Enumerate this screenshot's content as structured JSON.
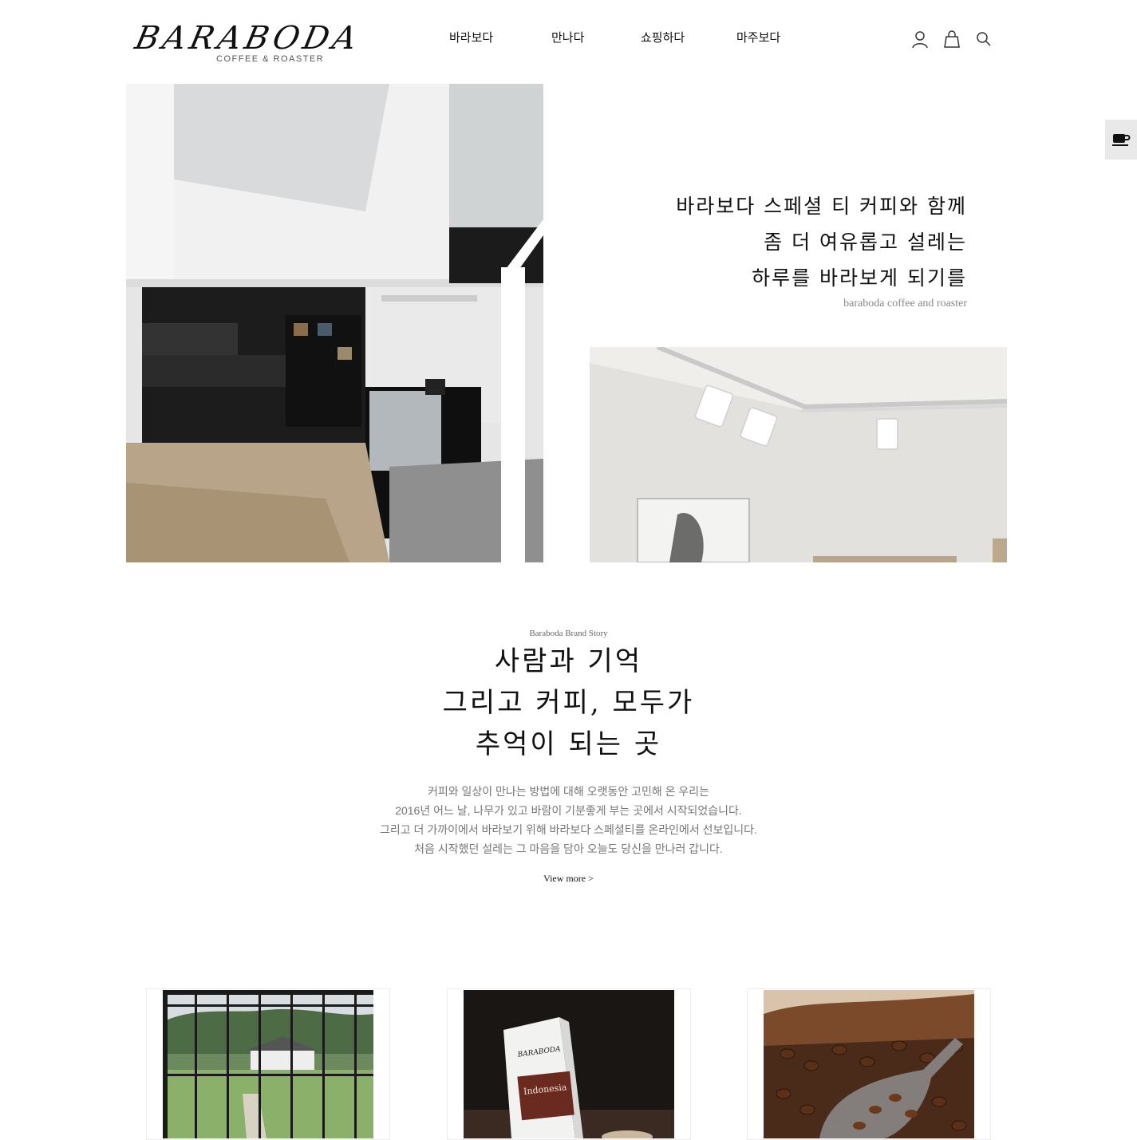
{
  "brand": {
    "name": "BARABODA",
    "tagline": "COFFEE & ROASTER"
  },
  "nav": {
    "items": [
      "바라보다",
      "만나다",
      "쇼핑하다",
      "마주보다"
    ]
  },
  "header_icons": [
    "user-icon",
    "shopping-bag-icon",
    "search-icon"
  ],
  "side_button": {
    "icon": "coffee-cup-icon"
  },
  "hero": {
    "lines": [
      "바라보다 스페셜 티 커피와 함께",
      "좀 더 여유롭고 설레는",
      "하루를 바라보게 되기를"
    ],
    "subtitle": "baraboda coffee and roaster"
  },
  "story": {
    "eyebrow": "Baraboda Brand Story",
    "title_lines": [
      "사람과 기억",
      "그리고 커피, 모두가",
      "추억이 되는 곳"
    ],
    "body_lines": [
      "커피와 일상이 만나는 방법에 대해 오랫동안 고민해 온 우리는",
      "2016년 어느 날, 나무가 있고 바람이 기분좋게 부는 곳에서 시작되었습니다.",
      "그리고 더 가까이에서 바라보기 위해 바라보다 스페셜티를 온라인에서 선보입니다.",
      "처음 시작했던 설레는 그 마음을 담아 오늘도 당신을 만나러 갑니다."
    ],
    "view_more": "View more >"
  },
  "cards": [
    {
      "image": "cafe-exterior-photo"
    },
    {
      "image": "coffee-bag-photo",
      "bag_brand": "BARABODA",
      "bag_label": "Indonesia"
    },
    {
      "image": "coffee-beans-photo"
    }
  ],
  "colors": {
    "background": "#ffffff",
    "text": "#111111",
    "muted": "#777777",
    "side_button_bg": "#e9e9e9"
  }
}
